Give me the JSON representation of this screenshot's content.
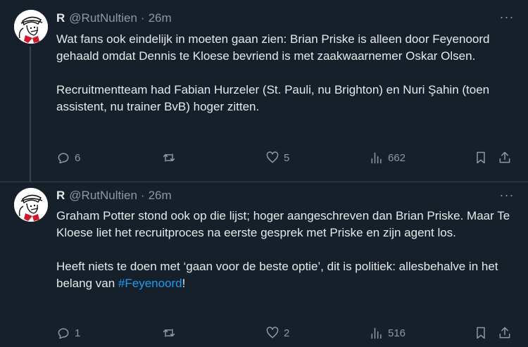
{
  "tweets": [
    {
      "name": "R",
      "handle": "@RutNultien",
      "separator": "·",
      "time": "26m",
      "more": "···",
      "paragraphs": [
        "Wat fans ook eindelijk in moeten gaan zien: Brian Priske is alleen door Feyenoord gehaald omdat Dennis te Kloese bevriend is met zaakwaarnemer Oskar Olsen.",
        "Recruitmentteam had Fabian Hurzeler (St. Pauli, nu Brighton) en Nuri Şahin (toen assistent, nu trainer BvB) hoger zitten."
      ],
      "replies": "6",
      "retweets": "",
      "likes": "5",
      "views": "662"
    },
    {
      "name": "R",
      "handle": "@RutNultien",
      "separator": "·",
      "time": "26m",
      "more": "···",
      "paragraphs": [
        "Graham Potter stond ook op die lijst; hoger aangeschreven dan Brian Priske. Maar Te Kloese liet het recruitproces na eerste gesprek met Priske en zijn agent los."
      ],
      "last_paragraph_text": "Heeft niets te doen met ‘gaan voor de beste optie’, dit is politiek: allesbehalve in het belang van ",
      "hashtag": "#Feyenoord",
      "last_paragraph_end": "!",
      "replies": "1",
      "retweets": "",
      "likes": "2",
      "views": "516"
    }
  ],
  "icons": {
    "reply": "reply-icon",
    "retweet": "retweet-icon",
    "like": "heart-icon",
    "views": "views-icon",
    "bookmark": "bookmark-icon",
    "share": "share-icon",
    "more": "more-icon"
  },
  "colors": {
    "background": "#15202b",
    "text": "#e7e9ea",
    "secondary": "#8b98a5",
    "link": "#1d9bf0",
    "divider": "#38444d"
  }
}
